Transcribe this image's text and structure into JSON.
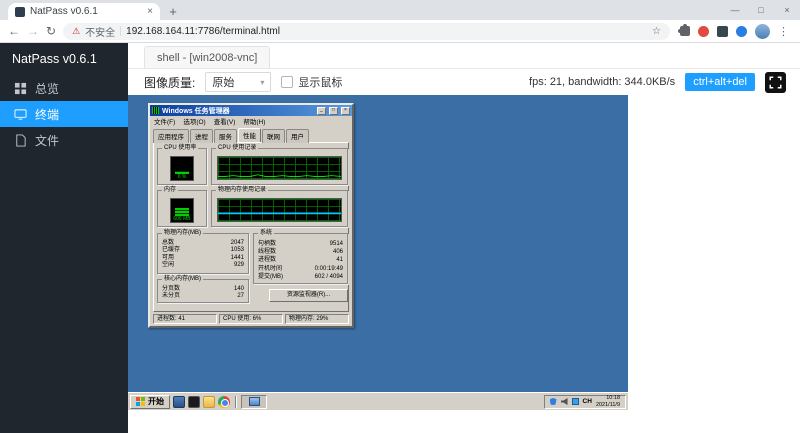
{
  "icons": {
    "close": "×",
    "plus": "+",
    "minimize": "—",
    "maximize": "□",
    "back": "←",
    "forward": "→",
    "reload": "↻",
    "warning": "⚠",
    "star": "☆",
    "kebab": "⋮",
    "caret": "▾",
    "tm_min": "_",
    "tm_max": "□",
    "tm_close": "×"
  },
  "browser": {
    "tab_title": "NatPass v0.6.1",
    "security_label": "不安全",
    "url": "192.168.164.11:7786/terminal.html"
  },
  "app": {
    "brand": "NatPass v0.6.1",
    "sidebar": [
      {
        "label": "总览"
      },
      {
        "label": "终端"
      },
      {
        "label": "文件"
      }
    ],
    "tab_label": "shell - [win2008-vnc]",
    "toolbar": {
      "quality_label": "图像质量:",
      "quality_value": "原始",
      "cursor_label": "显示鼠标",
      "stats": "fps: 21, bandwidth: 344.0KB/s",
      "cad_button": "ctrl+alt+del"
    }
  },
  "remote": {
    "taskmgr": {
      "title": "Windows 任务管理器",
      "menu": [
        "文件(F)",
        "选项(O)",
        "查看(V)",
        "帮助(H)"
      ],
      "tabs": [
        "应用程序",
        "进程",
        "服务",
        "性能",
        "联网",
        "用户"
      ],
      "cpu_gauge": {
        "label": "CPU 使用率",
        "value": "6 %"
      },
      "cpu_history": {
        "label": "CPU 使用记录"
      },
      "mem_gauge": {
        "label": "内存",
        "value": "606 MB"
      },
      "mem_history": {
        "label": "物理内存使用记录"
      },
      "phys_mem": {
        "label": "物理内存(MB)",
        "rows": [
          {
            "k": "总数",
            "v": "2047"
          },
          {
            "k": "已缓存",
            "v": "1053"
          },
          {
            "k": "可用",
            "v": "1441"
          },
          {
            "k": "空闲",
            "v": "929"
          }
        ]
      },
      "kernel_mem": {
        "label": "核心内存(MB)",
        "rows": [
          {
            "k": "分页数",
            "v": "140"
          },
          {
            "k": "未分页",
            "v": "27"
          }
        ]
      },
      "system": {
        "label": "系统",
        "rows": [
          {
            "k": "句柄数",
            "v": "9514"
          },
          {
            "k": "线程数",
            "v": "406"
          },
          {
            "k": "进程数",
            "v": "41"
          },
          {
            "k": "开机时间",
            "v": "0:00:19:49"
          },
          {
            "k": "提交(MB)",
            "v": "602 / 4094"
          }
        ]
      },
      "resmon_button": "资源监视器(R)...",
      "status": [
        "进程数: 41",
        "CPU 使用: 6%",
        "物理内存: 29%"
      ]
    },
    "taskbar": {
      "start_label": "开始",
      "language": "CH",
      "time": "10:18",
      "date": "2021/11/9"
    }
  },
  "colors": {
    "accent_blue": "#1e9fff",
    "desktop_blue": "#3a6ea5",
    "gauge_green": "#00d000",
    "history_cyan": "#00ccff"
  }
}
